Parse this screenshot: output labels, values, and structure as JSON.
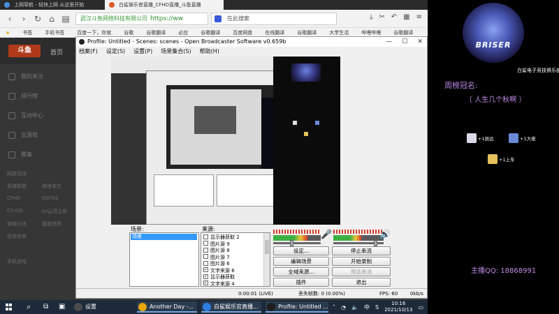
{
  "browser": {
    "tabs": [
      {
        "label": "上网导航 - 轻快上网 从这里开始",
        "active": false
      },
      {
        "label": "白鲨娱乐官直播_CFHD直播_斗鱼直播",
        "active": true
      }
    ],
    "address_site": "武汉斗鱼网络科技有限公司",
    "address_url": "https://ww",
    "search_placeholder": "在此搜索",
    "bookmarks": [
      "书签",
      "手机书签",
      "百度一下，你就",
      "谷歌",
      "谷歌翻译",
      "必应",
      "谷歌翻译",
      "百度网盘",
      "在线翻译",
      "谷歌翻译",
      "大学生活",
      "哔哩哔哩",
      "谷歌翻译"
    ]
  },
  "douyu": {
    "logo": "斗鱼",
    "home": "首页",
    "side_items": [
      "我的关注",
      "排行榜",
      "互动中心",
      "云游戏",
      "赛事"
    ],
    "side_small": [
      "网游竞技",
      "英雄联盟",
      "绝地求生",
      "CFHD",
      "DOTA2",
      "CS:GO",
      "lol云顶之弈",
      "穿越火线",
      "魔兽世界",
      "坦克世界",
      "手机游戏"
    ]
  },
  "obs": {
    "title": "Profile: Untitled - Scenes: scenes - Open Broadcaster Software v0.659b",
    "menu": [
      "档案(F)",
      "设定(S)",
      "设置(P)",
      "场景集合(S)",
      "帮助(H)"
    ],
    "scenes_label": "场景:",
    "sources_label": "来源:",
    "scenes": [
      "场景"
    ],
    "sources": [
      {
        "label": "显示器获取 2",
        "checked": false
      },
      {
        "label": "图片源 9",
        "checked": false
      },
      {
        "label": "图片源 8",
        "checked": false
      },
      {
        "label": "图片源 7",
        "checked": false
      },
      {
        "label": "图片源 6",
        "checked": false
      },
      {
        "label": "文字来源 6",
        "checked": true
      },
      {
        "label": "显示器获取",
        "checked": true
      },
      {
        "label": "文字来源 4",
        "checked": true
      }
    ],
    "buttons": {
      "settings": "设定...",
      "stop_stream": "停止串流",
      "edit_scene": "编辑场景",
      "start_record": "开始录制",
      "global_sources": "全域来源...",
      "preview_stream": "预览串流",
      "plugins": "插件",
      "exit": "退出"
    },
    "status": {
      "time": "0:00:01 (LIVE)",
      "dropped": "丢失帧数: 0 (0.00%)",
      "fps": "FPS: 60",
      "bitrate": "0kb/s"
    },
    "meters": {
      "mic_level": 0.72,
      "desktop_level": 0.55,
      "mic_volume": 0.4,
      "desktop_volume": 0.85
    }
  },
  "overlay": {
    "logo_text": "BRISER",
    "club": "白鲨电子竞技俱乐部",
    "title": "周榜冠名:",
    "subtitle": "〔 人生几个秋啊 〕",
    "gifts": [
      {
        "text": "+1辰远",
        "color": "#d9d9e8"
      },
      {
        "text": "+1大佬",
        "color": "#6a8ad8"
      },
      {
        "text": "+1上车",
        "color": "#e6c05a"
      }
    ],
    "qq": "主播QQ: 18868991"
  },
  "taskbar": {
    "apps": [
      {
        "label": "设置",
        "color": "#4a4a4a"
      },
      {
        "label": "Another Day -...",
        "color": "#e6a400"
      },
      {
        "label": "白鲨娱乐官直播...",
        "color": "#2f7de1"
      },
      {
        "label": "Profile: Untitled ...",
        "color": "#1e1e1e"
      }
    ],
    "tray_lang": "中",
    "tray_s": "S",
    "clock_time": "10:16",
    "clock_date": "2021/10/13"
  },
  "colors": {
    "accent_purple": "#c08be8",
    "obs_select": "#3399ff",
    "douyu_brand": "#b03a1a"
  }
}
